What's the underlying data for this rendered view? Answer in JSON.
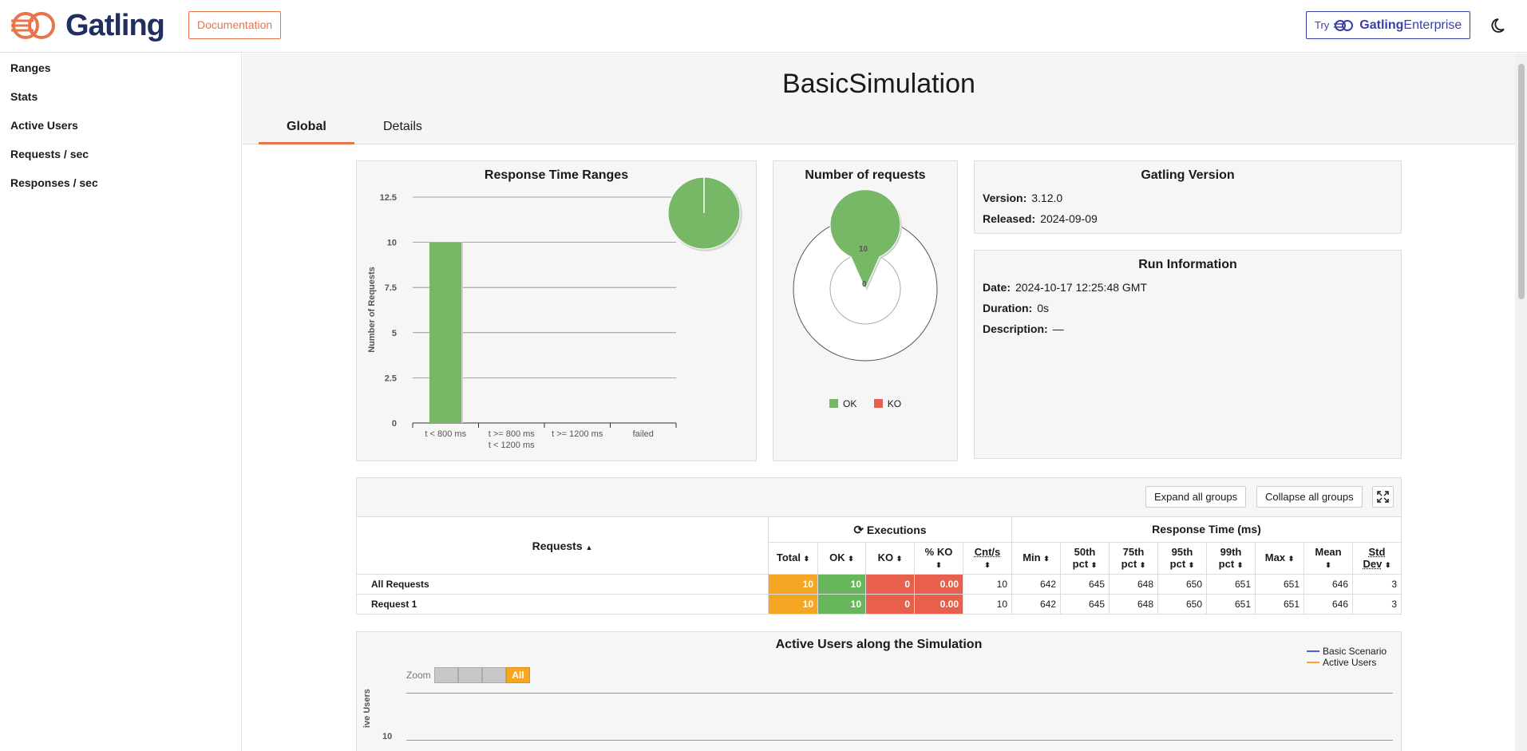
{
  "header": {
    "brand": "Gatling",
    "doc_label": "Documentation",
    "enterprise_try": "Try",
    "enterprise_brand": "Gatling",
    "enterprise_suffix": "Enterprise"
  },
  "sidebar": {
    "items": [
      {
        "label": "Ranges"
      },
      {
        "label": "Stats"
      },
      {
        "label": "Active Users"
      },
      {
        "label": "Requests / sec"
      },
      {
        "label": "Responses / sec"
      }
    ]
  },
  "page": {
    "title": "BasicSimulation",
    "tabs": [
      {
        "label": "Global",
        "active": true
      },
      {
        "label": "Details",
        "active": false
      }
    ]
  },
  "ranges_card": {
    "title": "Response Time Ranges",
    "chart_data": {
      "type": "bar",
      "categories": [
        "t < 800 ms",
        "t >= 800 ms t < 1200 ms",
        "t >= 1200 ms",
        "failed"
      ],
      "category_lines": [
        [
          "t < 800 ms"
        ],
        [
          "t >= 800 ms",
          "t < 1200 ms"
        ],
        [
          "t >= 1200 ms"
        ],
        [
          "failed"
        ]
      ],
      "values": [
        10,
        0,
        0,
        0
      ],
      "ylabel": "Number of Requests",
      "ylim": [
        0,
        12.5
      ],
      "yticks": [
        "0",
        "2.5",
        "5",
        "7.5",
        "10",
        "12.5"
      ],
      "color": "#76b865",
      "pie": {
        "values": [
          10,
          0,
          0,
          0
        ]
      }
    }
  },
  "requests_card": {
    "title": "Number of requests",
    "chart_data": {
      "type": "pie",
      "labels": [
        "OK",
        "KO"
      ],
      "values": [
        10,
        0
      ],
      "value_labels": [
        "10",
        "0"
      ],
      "colors": [
        "#76b865",
        "#e8604c"
      ]
    },
    "legend": [
      {
        "label": "OK",
        "color": "#76b865"
      },
      {
        "label": "KO",
        "color": "#e8604c"
      }
    ]
  },
  "version_card": {
    "title": "Gatling Version",
    "version_label": "Version:",
    "version_value": "3.12.0",
    "released_label": "Released:",
    "released_value": "2024-09-09"
  },
  "run_card": {
    "title": "Run Information",
    "date_label": "Date:",
    "date_value": "2024-10-17 12:25:48 GMT",
    "duration_label": "Duration:",
    "duration_value": "0s",
    "description_label": "Description:",
    "description_value": "—"
  },
  "stats": {
    "expand_label": "Expand all groups",
    "collapse_label": "Collapse all groups",
    "requests_header": "Requests",
    "executions_header": "Executions",
    "response_time_header": "Response Time (ms)",
    "columns": {
      "total": "Total",
      "ok": "OK",
      "ko": "KO",
      "pct_ko": "% KO",
      "cnt": "Cnt/s",
      "min": "Min",
      "p50_a": "50th",
      "p50_b": "pct",
      "p75_a": "75th",
      "p75_b": "pct",
      "p95_a": "95th",
      "p95_b": "pct",
      "p99_a": "99th",
      "p99_b": "pct",
      "max": "Max",
      "mean": "Mean",
      "std_a": "Std",
      "std_b": "Dev"
    },
    "rows": [
      {
        "name": "All Requests",
        "total": "10",
        "ok": "10",
        "ko": "0",
        "pct_ko": "0.00",
        "cnt": "10",
        "min": "642",
        "p50": "645",
        "p75": "648",
        "p95": "650",
        "p99": "651",
        "max": "651",
        "mean": "646",
        "std": "3"
      },
      {
        "name": "Request 1",
        "total": "10",
        "ok": "10",
        "ko": "0",
        "pct_ko": "0.00",
        "cnt": "10",
        "min": "642",
        "p50": "645",
        "p75": "648",
        "p95": "650",
        "p99": "651",
        "max": "651",
        "mean": "646",
        "std": "3"
      }
    ]
  },
  "active_users_card": {
    "title": "Active Users along the Simulation",
    "zoom_label": "Zoom",
    "zoom_all": "All",
    "legend": [
      {
        "label": "Basic Scenario",
        "color": "#4a5fd6"
      },
      {
        "label": "Active Users",
        "color": "#f5a623"
      }
    ],
    "ylabel_visible": "ive Users",
    "ytick_visible": "10"
  },
  "colors": {
    "accent": "#e8744a",
    "brand_navy": "#1f2f5f",
    "enterprise": "#3a3fa8",
    "ok": "#76b865",
    "ko": "#e8604c",
    "total": "#f5a623"
  }
}
